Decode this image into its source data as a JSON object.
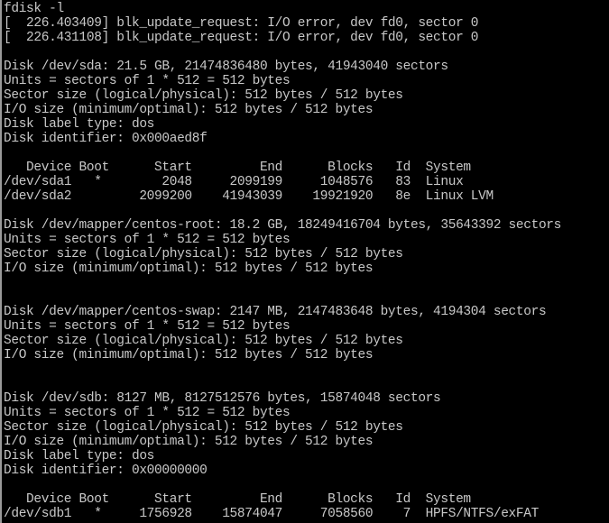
{
  "terminal": {
    "title": "fdisk -l",
    "colors": {
      "background": "#000000",
      "foreground": "#c8c8c8",
      "edge_strip": "#9a9a9a"
    },
    "command": "fdisk -l",
    "kernel_messages": [
      "[  226.403409] blk_update_request: I/O error, dev fd0, sector 0",
      "[  226.431108] blk_update_request: I/O error, dev fd0, sector 0"
    ],
    "lines": [
      "fdisk -l",
      "[  226.403409] blk_update_request: I/O error, dev fd0, sector 0",
      "[  226.431108] blk_update_request: I/O error, dev fd0, sector 0",
      "",
      "Disk /dev/sda: 21.5 GB, 21474836480 bytes, 41943040 sectors",
      "Units = sectors of 1 * 512 = 512 bytes",
      "Sector size (logical/physical): 512 bytes / 512 bytes",
      "I/O size (minimum/optimal): 512 bytes / 512 bytes",
      "Disk label type: dos",
      "Disk identifier: 0x000aed8f",
      "",
      "   Device Boot      Start         End      Blocks   Id  System",
      "/dev/sda1   *        2048     2099199     1048576   83  Linux",
      "/dev/sda2         2099200    41943039    19921920   8e  Linux LVM",
      "",
      "Disk /dev/mapper/centos-root: 18.2 GB, 18249416704 bytes, 35643392 sectors",
      "Units = sectors of 1 * 512 = 512 bytes",
      "Sector size (logical/physical): 512 bytes / 512 bytes",
      "I/O size (minimum/optimal): 512 bytes / 512 bytes",
      "",
      "",
      "Disk /dev/mapper/centos-swap: 2147 MB, 2147483648 bytes, 4194304 sectors",
      "Units = sectors of 1 * 512 = 512 bytes",
      "Sector size (logical/physical): 512 bytes / 512 bytes",
      "I/O size (minimum/optimal): 512 bytes / 512 bytes",
      "",
      "",
      "Disk /dev/sdb: 8127 MB, 8127512576 bytes, 15874048 sectors",
      "Units = sectors of 1 * 512 = 512 bytes",
      "Sector size (logical/physical): 512 bytes / 512 bytes",
      "I/O size (minimum/optimal): 512 bytes / 512 bytes",
      "Disk label type: dos",
      "Disk identifier: 0x00000000",
      "",
      "   Device Boot      Start         End      Blocks   Id  System",
      "/dev/sdb1   *     1756928    15874047     7058560    7  HPFS/NTFS/exFAT"
    ],
    "disks": [
      {
        "device": "/dev/sda",
        "size_human": "21.5 GB",
        "size_bytes": "21474836480 bytes",
        "sectors": "41943040 sectors",
        "units": "sectors of 1 * 512 = 512 bytes",
        "sector_size": "512 bytes / 512 bytes",
        "io_size": "512 bytes / 512 bytes",
        "label_type": "dos",
        "identifier": "0x000aed8f",
        "table": {
          "headers": [
            "Device",
            "Boot",
            "Start",
            "End",
            "Blocks",
            "Id",
            "System"
          ],
          "rows": [
            {
              "device": "/dev/sda1",
              "boot": "*",
              "start": "2048",
              "end": "2099199",
              "blocks": "1048576",
              "id": "83",
              "system": "Linux"
            },
            {
              "device": "/dev/sda2",
              "boot": "",
              "start": "2099200",
              "end": "41943039",
              "blocks": "19921920",
              "id": "8e",
              "system": "Linux LVM"
            }
          ]
        }
      },
      {
        "device": "/dev/mapper/centos-root",
        "size_human": "18.2 GB",
        "size_bytes": "18249416704 bytes",
        "sectors": "35643392 sectors",
        "units": "sectors of 1 * 512 = 512 bytes",
        "sector_size": "512 bytes / 512 bytes",
        "io_size": "512 bytes / 512 bytes",
        "label_type": "",
        "identifier": "",
        "table": null
      },
      {
        "device": "/dev/mapper/centos-swap",
        "size_human": "2147 MB",
        "size_bytes": "2147483648 bytes",
        "sectors": "4194304 sectors",
        "units": "sectors of 1 * 512 = 512 bytes",
        "sector_size": "512 bytes / 512 bytes",
        "io_size": "512 bytes / 512 bytes",
        "label_type": "",
        "identifier": "",
        "table": null
      },
      {
        "device": "/dev/sdb",
        "size_human": "8127 MB",
        "size_bytes": "8127512576 bytes",
        "sectors": "15874048 sectors",
        "units": "sectors of 1 * 512 = 512 bytes",
        "sector_size": "512 bytes / 512 bytes",
        "io_size": "512 bytes / 512 bytes",
        "label_type": "dos",
        "identifier": "0x00000000",
        "table": {
          "headers": [
            "Device",
            "Boot",
            "Start",
            "End",
            "Blocks",
            "Id",
            "System"
          ],
          "rows": [
            {
              "device": "/dev/sdb1",
              "boot": "*",
              "start": "1756928",
              "end": "15874047",
              "blocks": "7058560",
              "id": "7",
              "system": "HPFS/NTFS/exFAT"
            }
          ]
        }
      }
    ]
  }
}
